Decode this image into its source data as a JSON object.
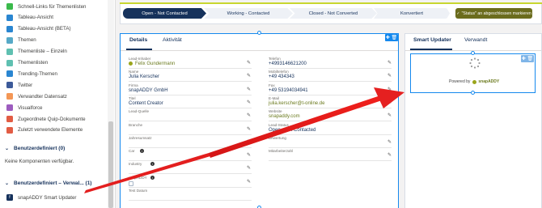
{
  "sidebar": {
    "items": [
      {
        "label": "Schnell-Links für Themenlisten",
        "icon": "link-list-icon",
        "color": "#3bba4c"
      },
      {
        "label": "Tableau-Ansicht",
        "icon": "tableau-icon",
        "color": "#2a86d1"
      },
      {
        "label": "Tableau-Ansicht (BETA)",
        "icon": "tableau-beta-icon",
        "color": "#2a86d1"
      },
      {
        "label": "Themen",
        "icon": "topics-icon",
        "color": "#56a9c7"
      },
      {
        "label": "Themenliste – Einzeln",
        "icon": "topic-list-single-icon",
        "color": "#5fc0b1"
      },
      {
        "label": "Themenlisten",
        "icon": "topic-lists-icon",
        "color": "#5fc0b1"
      },
      {
        "label": "Trending-Themen",
        "icon": "trending-topics-icon",
        "color": "#2a86d1"
      },
      {
        "label": "Twitter",
        "icon": "twitter-icon",
        "color": "#3c5a99"
      },
      {
        "label": "Verwandter Datensatz",
        "icon": "related-record-icon",
        "color": "#f49756"
      },
      {
        "label": "Visualforce",
        "icon": "visualforce-icon",
        "color": "#9d5cbf"
      },
      {
        "label": "Zugeordnete Quip-Dokumente",
        "icon": "quip-icon",
        "color": "#e25c44"
      },
      {
        "label": "Zuletzt verwendete Elemente",
        "icon": "recent-items-icon",
        "color": "#e25c44"
      }
    ],
    "custom_section": {
      "title": "Benutzerdefiniert (0)",
      "empty_text": "Keine Komponenten verfügbar."
    },
    "managed_section": {
      "title": "Benutzerdefiniert – Verwal... (1)",
      "items": [
        {
          "label": "snapADDY Smart Updater",
          "icon": "lightning-component-icon"
        }
      ]
    }
  },
  "path": {
    "stages": [
      "Open - Not Contacted",
      "Working - Contacted",
      "Closed - Not Converted",
      "Konvertiert"
    ],
    "active_index": 0,
    "mark_button": "\"Status\" an abgeschlossen markieren"
  },
  "details": {
    "tabs": [
      "Details",
      "Aktivität"
    ],
    "active_tab": 0,
    "left_fields": [
      {
        "label": "Lead-Inhaber",
        "value": "Felix Gundermann",
        "link": true
      },
      {
        "label": "Name",
        "value": "Julia Kerscher"
      },
      {
        "label": "Firma",
        "value": "snapADDY GmbH"
      },
      {
        "label": "Titel",
        "value": "Content Creator"
      },
      {
        "label": "Lead-Quelle",
        "value": ""
      },
      {
        "label": "Branche",
        "value": ""
      },
      {
        "label": "Jahresumsatz",
        "value": ""
      },
      {
        "label": "Car",
        "value": ""
      },
      {
        "label": "Industry",
        "value": ""
      },
      {
        "label": "snapADDY",
        "value": ""
      },
      {
        "label": "Test Datum",
        "value": ""
      }
    ],
    "right_fields": [
      {
        "label": "Telefon",
        "value": "+4993146621200"
      },
      {
        "label": "Mobiltelefon",
        "value": "+49 434343"
      },
      {
        "label": "Fax",
        "value": "+49 53194034941"
      },
      {
        "label": "E-Mail",
        "value": "julia.kerscher@t-online.de",
        "link": true
      },
      {
        "label": "Website",
        "value": "snapaddy.com",
        "link": true
      },
      {
        "label": "Lead-Status",
        "value": "Open - Not Contacted"
      },
      {
        "label": "Bewertung",
        "value": ""
      },
      {
        "label": "Mitarbeiterzahl",
        "value": ""
      }
    ]
  },
  "smart_updater": {
    "tabs": [
      "Smart Updater",
      "Verwandt"
    ],
    "active_tab": 0,
    "powered_by": "Powered by",
    "brand": "snapADDY"
  },
  "colors": {
    "accent": "#c8d630",
    "path_active": "#16325c",
    "button": "#6b6c1d",
    "selection": "#1589ee",
    "arrow": "#e01b1b"
  }
}
